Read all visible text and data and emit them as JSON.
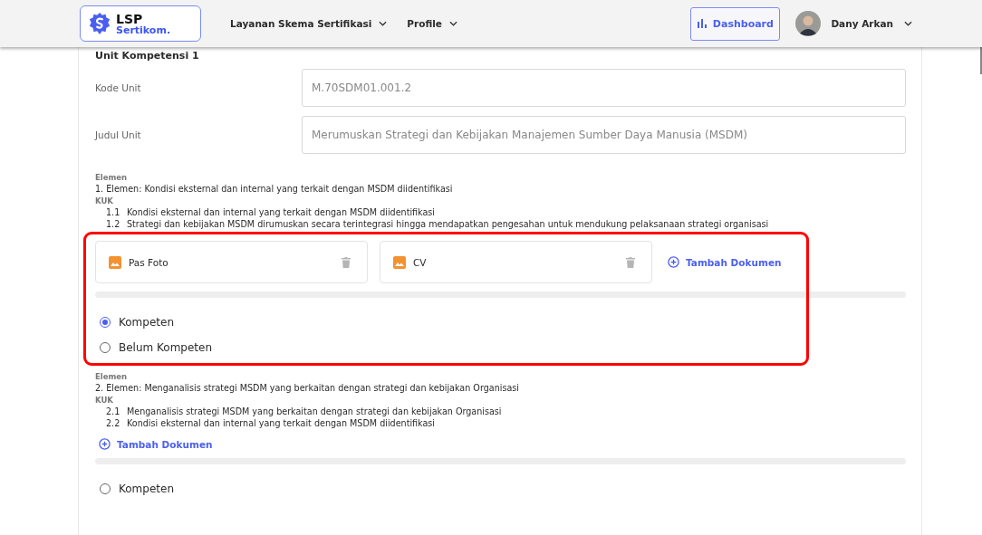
{
  "nav": {
    "logo": {
      "line1": "LSP",
      "line2": "Sertikom."
    },
    "menus": [
      {
        "label": "Layanan Skema Sertifikasi"
      },
      {
        "label": "Profile"
      }
    ],
    "dashboard": "Dashboard",
    "user": "Dany Arkan"
  },
  "unit": {
    "title": "Unit Kompetensi 1",
    "fields": [
      {
        "label": "Kode Unit",
        "value": "M.70SDM01.001.2"
      },
      {
        "label": "Judul Unit",
        "value": "Merumuskan Strategi dan Kebijakan Manajemen Sumber Daya Manusia (MSDM)"
      }
    ]
  },
  "elements": [
    {
      "heading": "Elemen",
      "title": "1.  Elemen: Kondisi eksternal dan internal yang terkait dengan MSDM diidentifikasi",
      "kuk_label": "KUK",
      "kuk": [
        {
          "number": "1.1",
          "text": "Kondisi eksternal dan internal yang terkait dengan MSDM diidentifikasi"
        },
        {
          "number": "1.2",
          "text": "Strategi dan kebijakan MSDM dirumuskan secara terintegrasi hingga mendapatkan pengesahan untuk mendukung pelaksanaan strategi organisasi"
        }
      ],
      "documents": [
        {
          "name": "Pas Foto"
        },
        {
          "name": "CV"
        }
      ],
      "add_label": "Tambah Dokumen",
      "options": [
        {
          "label": "Kompeten",
          "selected": true
        },
        {
          "label": "Belum Kompeten",
          "selected": false
        }
      ],
      "highlighted": true
    },
    {
      "heading": "Elemen",
      "title": "2.  Elemen: Menganalisis strategi MSDM yang berkaitan dengan strategi dan kebijakan Organisasi",
      "kuk_label": "KUK",
      "kuk": [
        {
          "number": "2.1",
          "text": "Menganalisis strategi MSDM yang berkaitan dengan strategi dan kebijakan Organisasi"
        },
        {
          "number": "2.2",
          "text": "Kondisi eksternal dan internal yang terkait dengan MSDM diidentifikasi"
        }
      ],
      "add_label": "Tambah Dokumen",
      "options": [
        {
          "label": "Kompeten",
          "selected": false
        }
      ],
      "highlighted": false
    }
  ]
}
